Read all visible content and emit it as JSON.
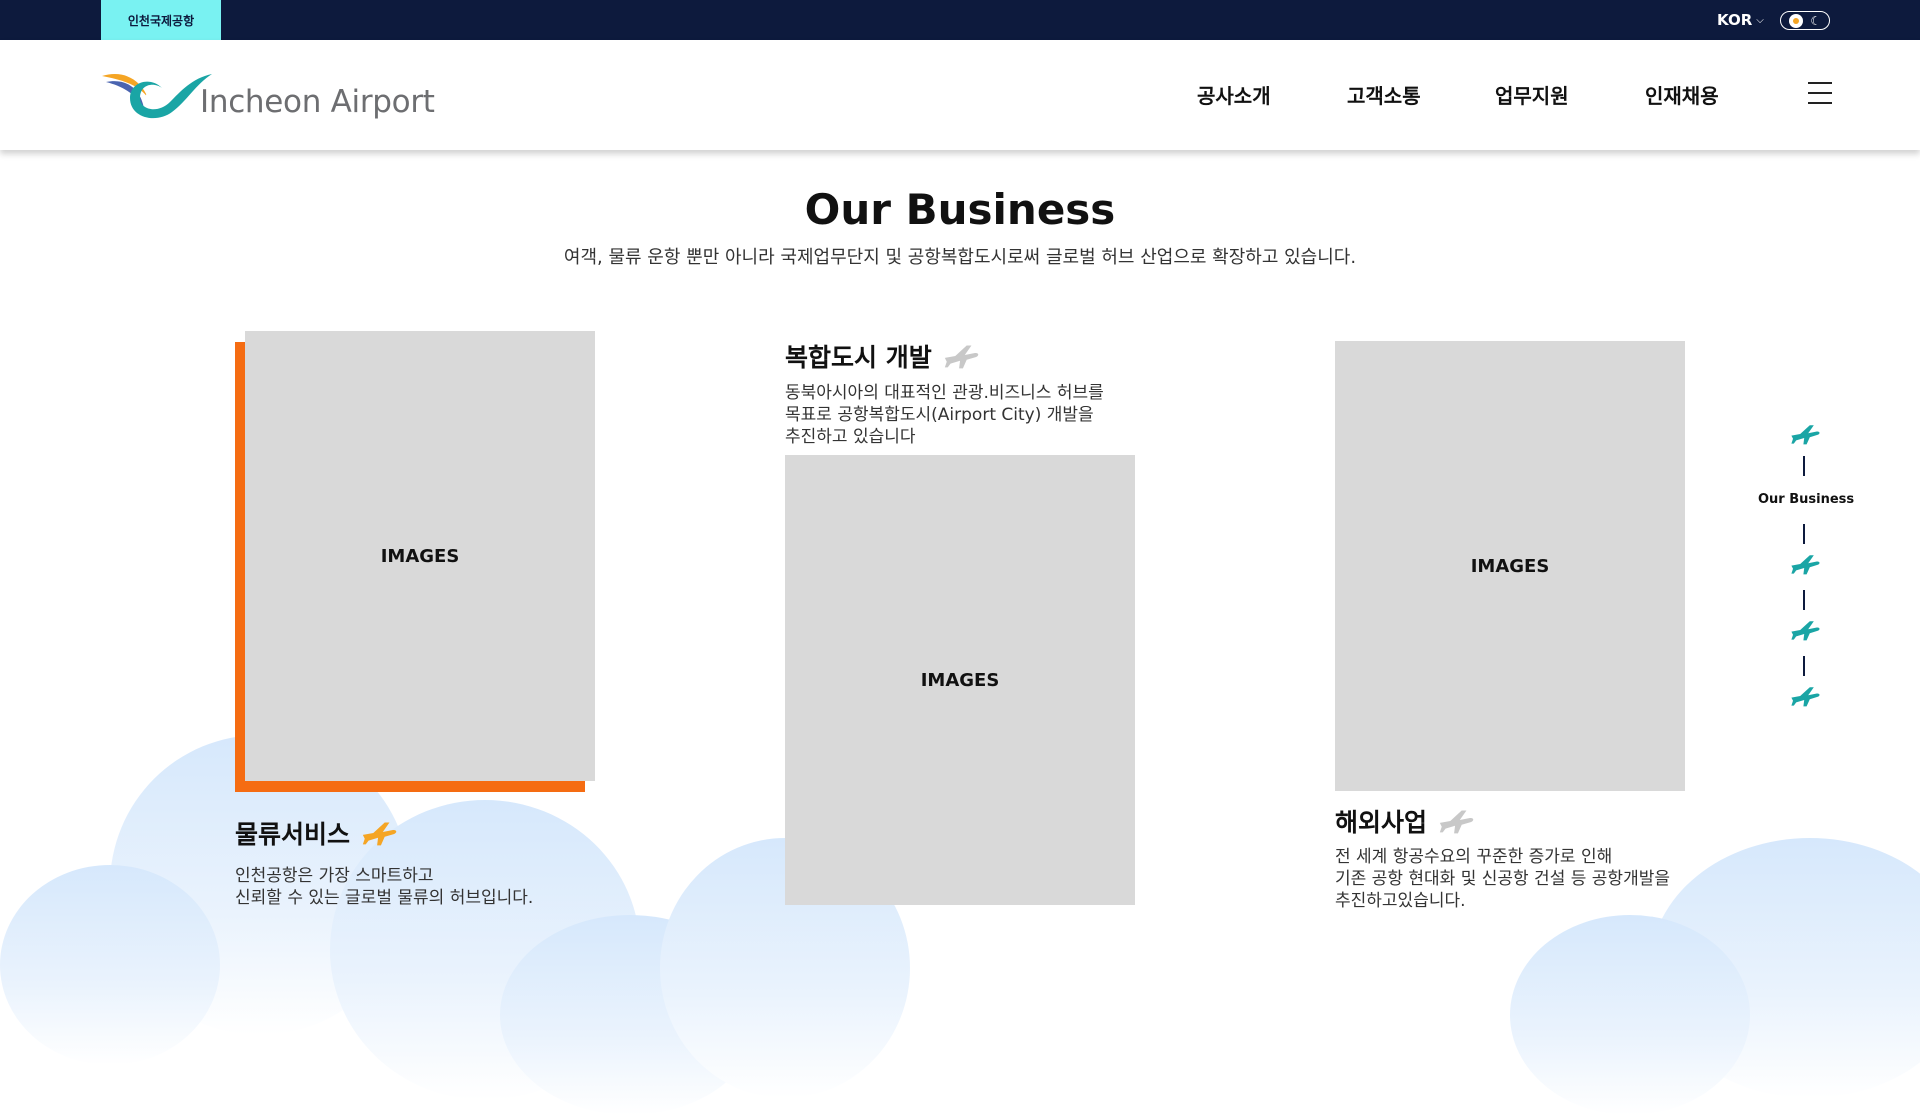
{
  "topbar": {
    "site_label": "인천국제공항",
    "language": "KOR"
  },
  "header": {
    "logo_text": "Incheon Airport",
    "nav": [
      "공사소개",
      "고객소통",
      "업무지원",
      "인재채용"
    ]
  },
  "section": {
    "title": "Our Business",
    "description": "여객, 물류 운항 뿐만 아니라 국제업무단지 및 공항복합도시로써 글로벌 허브 산업으로 확장하고 있습니다."
  },
  "cards": [
    {
      "title": "물류서비스",
      "description": "인천공항은 가장 스마트하고\n신뢰할 수 있는 글로벌 물류의 허브입니다.",
      "image_label": "IMAGES",
      "plane_color": "#f5a524"
    },
    {
      "title": "복합도시 개발",
      "description": "동북아시아의 대표적인 관광.비즈니스 허브를\n목표로 공항복합도시(Airport City) 개발을\n추진하고 있습니다",
      "image_label": "IMAGES",
      "plane_color": "#c8c8c8"
    },
    {
      "title": "해외사업",
      "description": "전 세계 항공수요의 꾸준한 증가로 인해\n기존 공항 현대화 및 신공항 건설 등 공항개발을\n추진하고있습니다.",
      "image_label": "IMAGES",
      "plane_color": "#c8c8c8"
    }
  ],
  "side_nav": {
    "active_label": "Our Business",
    "icon_color": "#1aa5a5"
  },
  "colors": {
    "topbar_bg": "#0d1a3d",
    "site_chip_bg": "#79f2f2",
    "accent_orange": "#f56c12",
    "placeholder_gray": "#d9d9d9"
  },
  "icons": {
    "theme_toggle": [
      "sun-icon",
      "moon-icon"
    ],
    "menu": "hamburger-icon",
    "card_title": "airplane-icon"
  }
}
